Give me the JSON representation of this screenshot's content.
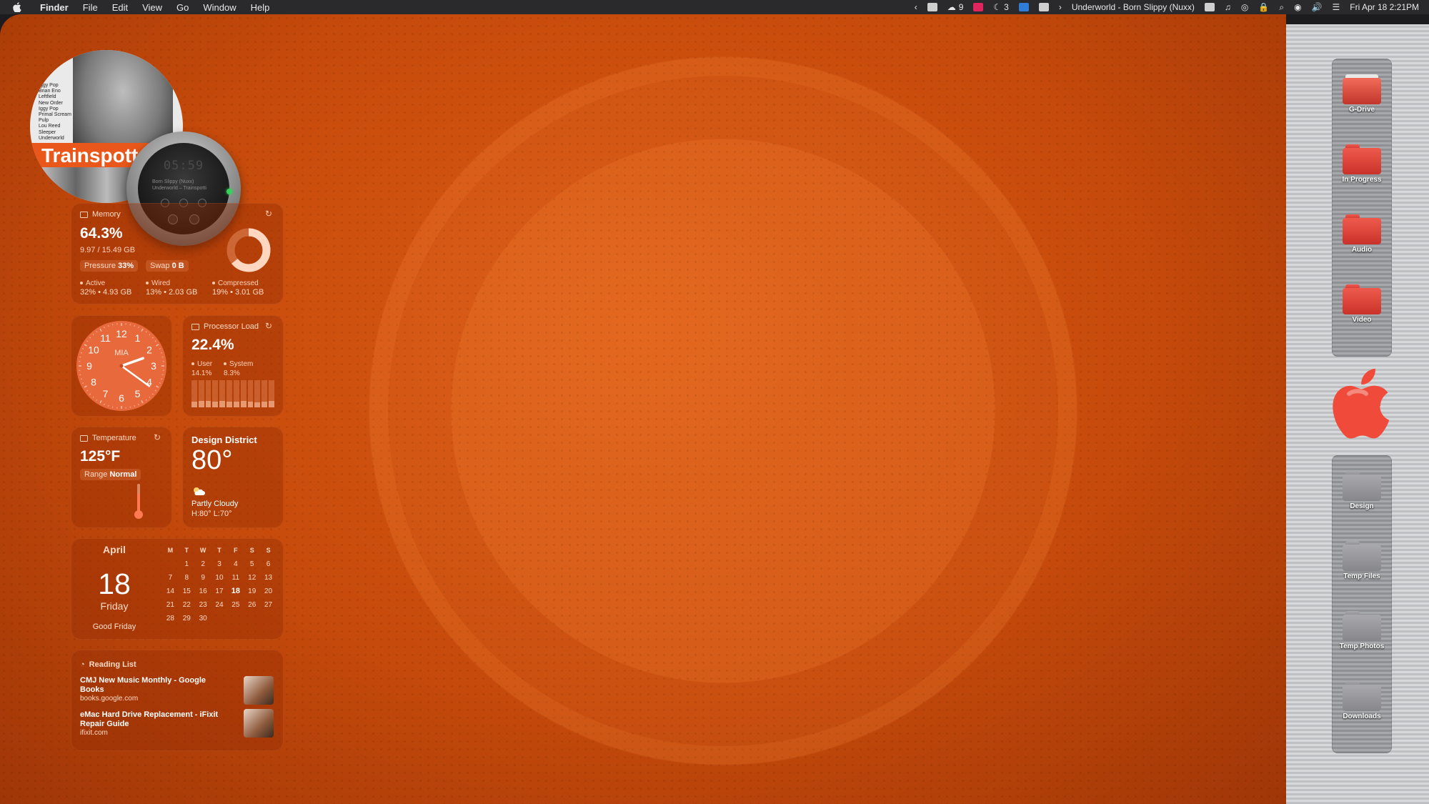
{
  "menubar": {
    "app": "Finder",
    "menus": [
      "File",
      "Edit",
      "View",
      "Go",
      "Window",
      "Help"
    ],
    "tray": {
      "count_a": "9",
      "count_b": "3",
      "now_playing": "Underworld - Born Slippy (Nuxx)",
      "datetime": "Fri Apr 18  2:21PM"
    }
  },
  "album": {
    "title": "Trainspott",
    "tracklist": [
      "Iggy Pop",
      "Brian Eno",
      "Leftfield",
      "New Order",
      "Iggy Pop",
      "Primal Scream",
      "Pulp",
      "Lou Reed",
      "Sleeper",
      "Underworld"
    ]
  },
  "player": {
    "time": "05:59",
    "track": "Born Slippy (Nuxx)",
    "artist": "Underworld – Trainspotti"
  },
  "memory": {
    "label": "Memory",
    "percent": "64.3%",
    "used": "9.97 / 15.49 GB",
    "pressure_label": "Pressure",
    "pressure_value": "33%",
    "swap_label": "Swap",
    "swap_value": "0 B",
    "stats": [
      {
        "name": "Active",
        "value": "32% • 4.93 GB"
      },
      {
        "name": "Wired",
        "value": "13% • 2.03 GB"
      },
      {
        "name": "Compressed",
        "value": "19% • 3.01 GB"
      }
    ],
    "usage_fraction": 0.643
  },
  "clock": {
    "city": "MIA",
    "numbers": [
      "12",
      "1",
      "2",
      "3",
      "4",
      "5",
      "6",
      "7",
      "8",
      "9",
      "10",
      "11"
    ],
    "hour": 2,
    "minute": 21
  },
  "cpu": {
    "label": "Processor Load",
    "percent": "22.4%",
    "user_label": "User",
    "user_value": "14.1%",
    "system_label": "System",
    "system_value": "8.3%",
    "history": [
      0.22,
      0.25,
      0.24,
      0.21,
      0.23,
      0.22,
      0.2,
      0.24,
      0.22,
      0.18,
      0.2,
      0.24
    ]
  },
  "temperature": {
    "label": "Temperature",
    "value": "125°F",
    "range_label": "Range",
    "range_value": "Normal"
  },
  "weather": {
    "location": "Design District",
    "temp": "80°",
    "condition": "Partly Cloudy",
    "high_low": "H:80° L:70°"
  },
  "calendar": {
    "month": "April",
    "day": "18",
    "weekday": "Friday",
    "holiday": "Good Friday",
    "headers": [
      "M",
      "T",
      "W",
      "T",
      "F",
      "S",
      "S"
    ],
    "leading_blanks": 1,
    "days_in_month": 30,
    "today": 18
  },
  "reading_list": {
    "label": "Reading List",
    "items": [
      {
        "title": "CMJ New Music Monthly - Google Books",
        "url": "books.google.com"
      },
      {
        "title": "eMac Hard Drive Replacement - iFixit Repair Guide",
        "url": "ifixit.com"
      }
    ]
  },
  "dock_top": [
    {
      "label": "G-Drive",
      "kind": "drive"
    },
    {
      "label": "In Progress",
      "kind": "red"
    },
    {
      "label": "Audio",
      "kind": "red"
    },
    {
      "label": "Video",
      "kind": "red"
    }
  ],
  "dock_bottom": [
    {
      "label": "Design",
      "kind": "grey"
    },
    {
      "label": "Temp Files",
      "kind": "grey"
    },
    {
      "label": "Temp Photos",
      "kind": "grey"
    },
    {
      "label": "Downloads",
      "kind": "grey"
    }
  ],
  "colors": {
    "desktop": "#c64a0b",
    "accent_red": "#e0245e",
    "apple_logo": "#ef4a3a"
  }
}
